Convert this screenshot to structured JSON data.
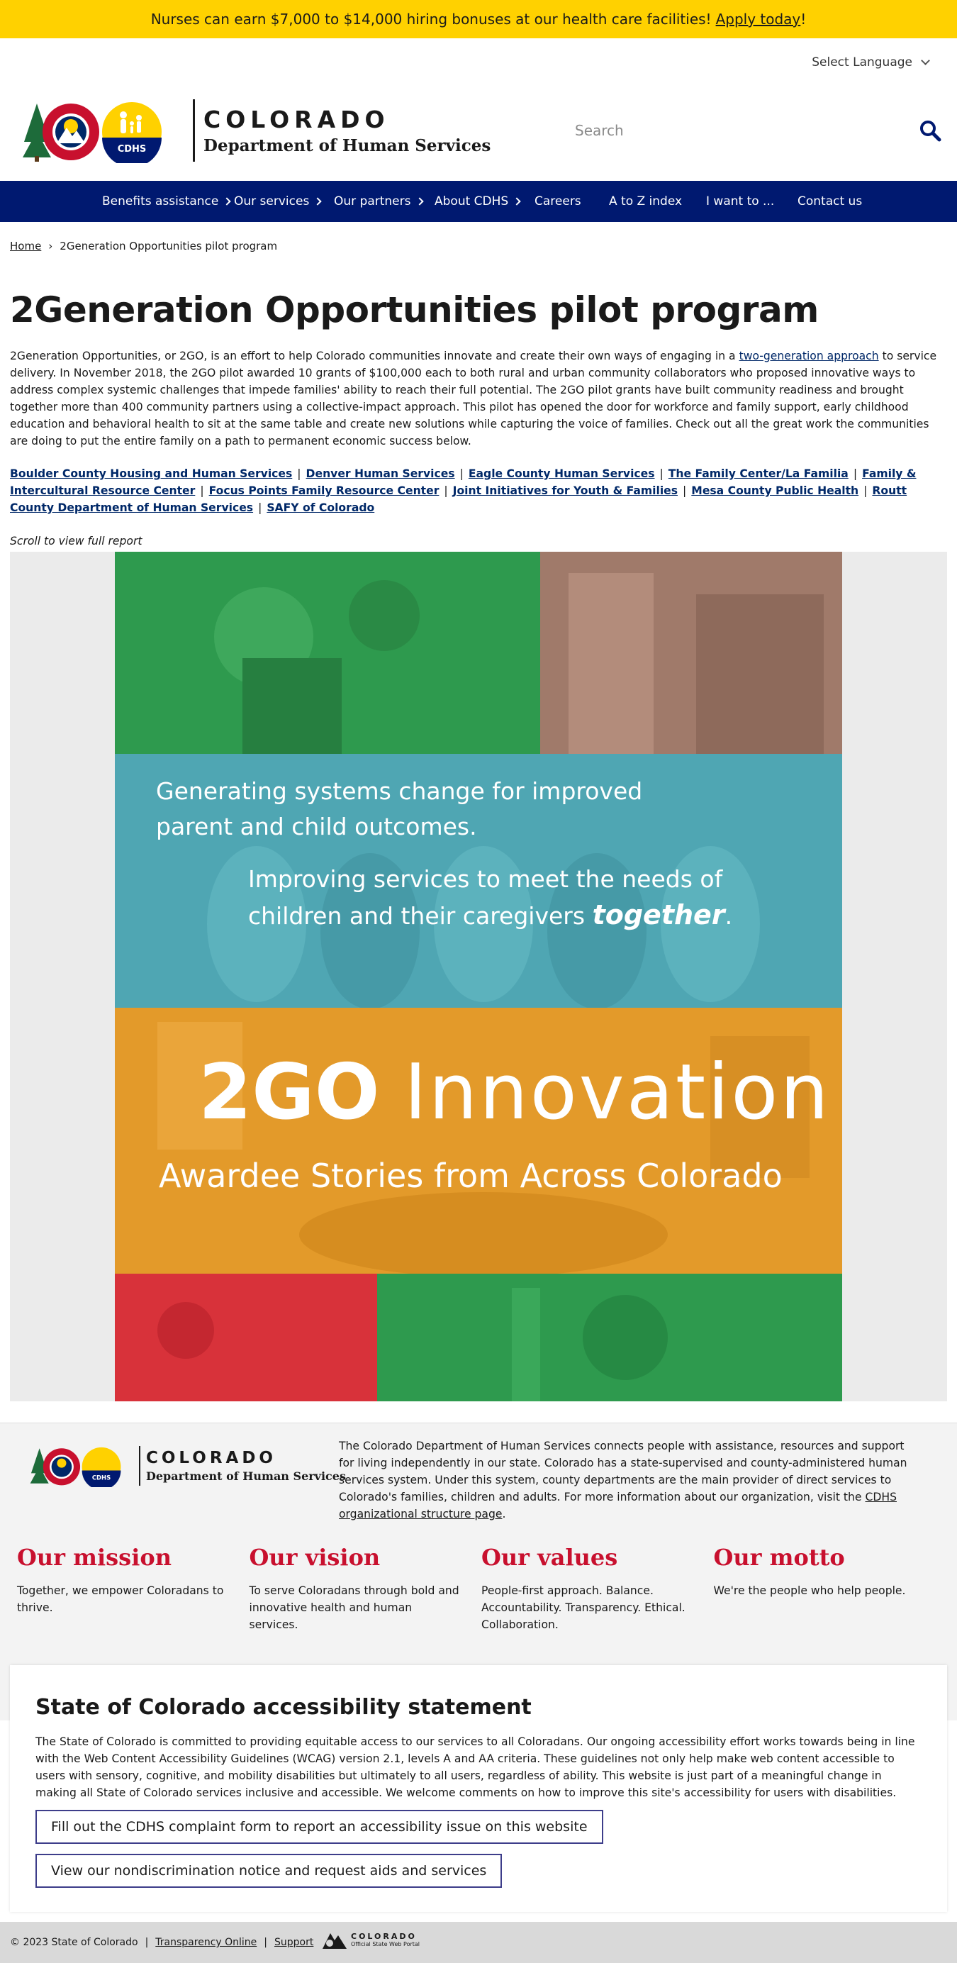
{
  "banner": {
    "text": "Nurses can earn $7,000 to $14,000 hiring bonuses at our health care facilities!",
    "link": "Apply today",
    "suffix": "!"
  },
  "language": {
    "label": "Select Language"
  },
  "header": {
    "logo_badge": "CDHS",
    "wordmark": "COLORADO",
    "department": "Department of Human Services"
  },
  "search": {
    "placeholder": "Search"
  },
  "nav": {
    "items": [
      {
        "label": "Benefits assistance"
      },
      {
        "label": "Our services"
      },
      {
        "label": "Our partners"
      },
      {
        "label": "About CDHS"
      },
      {
        "label": "Careers"
      },
      {
        "label": "A to Z index"
      },
      {
        "label": "I want to ..."
      },
      {
        "label": "Contact us"
      }
    ]
  },
  "breadcrumb": {
    "home": "Home",
    "separator": "›",
    "current": "2Generation Opportunities pilot program"
  },
  "page": {
    "title": "2Generation Opportunities pilot program",
    "intro_before": "2Generation Opportunities, or 2GO, is an effort to help Colorado communities innovate and create their own ways of engaging in a ",
    "intro_link": "two-generation approach",
    "intro_after": " to service delivery. In November 2018, the 2GO pilot awarded 10 grants of $100,000 each to both rural and urban community collaborators who proposed innovative ways to address complex systemic challenges that impede families' ability to reach their full potential. The 2GO pilot grants have built community readiness and brought together more than 400 community partners using a collective-impact approach. This pilot has opened the door for workforce and family support, early childhood education and behavioral health to sit at the same table and create new solutions while capturing the voice of families. Check out all the great work the communities are doing to put the entire family on a path to permanent economic success below.",
    "partners": [
      "Boulder County Housing and Human Services",
      "Denver Human Services",
      "Eagle County Human Services",
      "The Family Center/La Familia",
      "Family & Intercultural Resource Center",
      "Focus Points Family Resource Center",
      "Joint Initiatives for Youth & Families",
      "Mesa County Public Health",
      "Routt County Department of Human Services",
      "SAFY of Colorado"
    ],
    "partner_separator": "|",
    "scroll_note": "Scroll to view full report"
  },
  "report": {
    "line1a": "Generating systems change for improved",
    "line1b": "parent and child outcomes.",
    "line2a": "Improving services to meet the needs of",
    "line2b": "children and their caregivers",
    "line2_emph": "together",
    "line2_end": ".",
    "title_bold": "2GO",
    "title_light": "Innovation",
    "subtitle": "Awardee Stories from Across Colorado",
    "colors": {
      "green": "#2e9a4e",
      "brown": "#a07a6a",
      "teal": "#4fa6b3",
      "orange": "#e39a2a",
      "red": "#d8323a"
    }
  },
  "footer": {
    "about_before": "The Colorado Department of Human Services connects people with assistance, resources and support for living independently in our state. Colorado has a state-supervised and county-administered human services system. Under this system, county departments are the main provider of direct services to Colorado's families, children and adults. For more information about our organization, visit the ",
    "about_link": "CDHS organizational structure page",
    "about_after": ".",
    "values": [
      {
        "title": "Our mission",
        "text": "Together, we empower Coloradans to thrive."
      },
      {
        "title": "Our vision",
        "text": "To serve Coloradans through bold and innovative health and human services."
      },
      {
        "title": "Our values",
        "text": "People-first approach. Balance. Accountability. Transparency. Ethical. Collaboration."
      },
      {
        "title": "Our motto",
        "text": "We're the people who help people."
      }
    ]
  },
  "accessibility": {
    "title": "State of Colorado accessibility statement",
    "text": "The State of Colorado is committed to providing equitable access to our services to all Coloradans. Our ongoing accessibility effort works towards being in line with the Web Content Accessibility Guidelines (WCAG) version 2.1, levels A and AA criteria. These guidelines not only help make web content accessible to users with sensory, cognitive, and mobility disabilities but ultimately to all users, regardless of ability. This website is just part of a meaningful change in making all State of Colorado services inclusive and accessible. We welcome comments on how to improve this site's accessibility for users with disabilities.",
    "button1": "Fill out the CDHS complaint form to report an accessibility issue on this website",
    "button2": "View our nondiscrimination notice and request aids and services"
  },
  "bottom": {
    "copyright": "© 2023 State of Colorado",
    "link1": "Transparency Online",
    "link2": "Support",
    "pipe": "|",
    "portal_name": "COLORADO",
    "portal_sub": "Official State Web Portal"
  },
  "theme": {
    "banner": "#ffd100",
    "nav": "#001970",
    "accent_red": "#c8102e",
    "link": "#002868"
  }
}
